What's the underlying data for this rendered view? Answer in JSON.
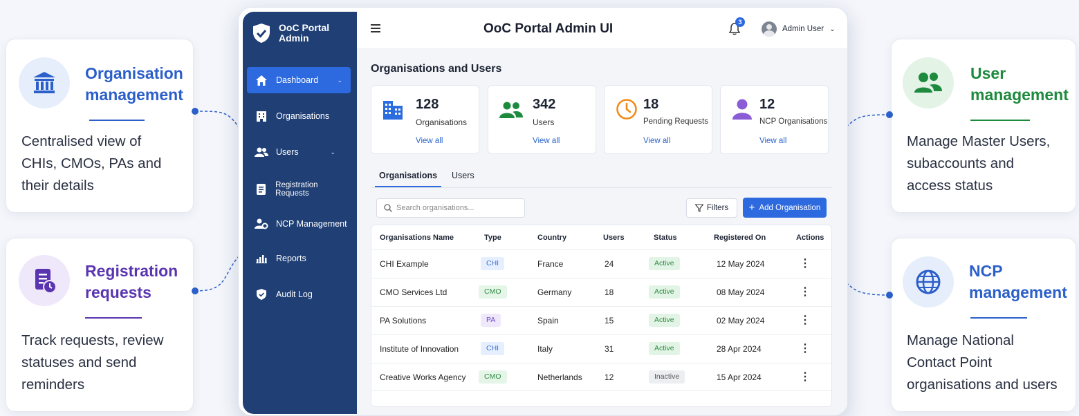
{
  "callouts": {
    "org": {
      "title_line1": "Organisation",
      "title_line2": "management",
      "desc_line1": "Centralised view of",
      "desc_line2": "CHIs, CMOs, PAs and",
      "desc_line3": "their details",
      "icon": "institution-icon",
      "color": "#2b5fc9"
    },
    "reg": {
      "title_line1": "Registration",
      "title_line2": "requests",
      "desc_line1": "Track requests, review",
      "desc_line2": "statuses and send",
      "desc_line3": "reminders",
      "icon": "document-clock-icon",
      "color": "#5a35b0"
    },
    "user": {
      "title_line1": "User",
      "title_line2": "management",
      "desc_line1": "Manage Master Users,",
      "desc_line2": "subaccounts and",
      "desc_line3": "access status",
      "icon": "users-icon",
      "color": "#1e8a3e"
    },
    "ncp": {
      "title_line1": "NCP",
      "title_line2": "management",
      "desc_line1": "Manage National",
      "desc_line2": "Contact Point",
      "desc_line3": "organisations and users",
      "icon": "globe-icon",
      "color": "#2b5fc9"
    }
  },
  "app": {
    "brand_line1": "OoC Portal",
    "brand_line2": "Admin",
    "title": "OoC Portal Admin UI",
    "notification_count": "3",
    "user_name": "Admin User",
    "colors": {
      "sidebar": "#1f3f75",
      "accent": "#2d6ae0"
    }
  },
  "sidebar": {
    "items": [
      {
        "label": "Dashboard",
        "icon": "home-icon"
      },
      {
        "label": "Organisations",
        "icon": "building-icon"
      },
      {
        "label": "Users",
        "icon": "users-icon"
      },
      {
        "label": "Registration Requests",
        "icon": "document-icon"
      },
      {
        "label": "NCP Management",
        "icon": "user-gear-icon"
      },
      {
        "label": "Reports",
        "icon": "bar-chart-icon"
      },
      {
        "label": "Audit Log",
        "icon": "shield-icon"
      }
    ]
  },
  "page": {
    "heading": "Organisations and Users",
    "stats": [
      {
        "value": "128",
        "label": "Organisations",
        "link": "View all"
      },
      {
        "value": "342",
        "label": "Users",
        "link": "View all"
      },
      {
        "value": "18",
        "label": "Pending Requests",
        "link": "View all"
      },
      {
        "value": "12",
        "label": "NCP Organisations",
        "link": "View all"
      }
    ],
    "tabs": [
      "Organisations",
      "Users"
    ],
    "search_placeholder": "Search organisations...",
    "filters_label": "Filters",
    "add_label": "Add Organisation",
    "columns": [
      "Organisations Name",
      "Type",
      "Country",
      "Users",
      "Status",
      "Registered On",
      "Actions"
    ],
    "rows": [
      {
        "name": "CHI Example",
        "type": "CHI",
        "country": "France",
        "users": "24",
        "status": "Active",
        "date": "12 May 2024"
      },
      {
        "name": "CMO Services Ltd",
        "type": "CMO",
        "country": "Germany",
        "users": "18",
        "status": "Active",
        "date": "08 May 2024"
      },
      {
        "name": "PA Solutions",
        "type": "PA",
        "country": "Spain",
        "users": "15",
        "status": "Active",
        "date": "02 May 2024"
      },
      {
        "name": "Institute of Innovation",
        "type": "CHI",
        "country": "Italy",
        "users": "31",
        "status": "Active",
        "date": "28 Apr 2024"
      },
      {
        "name": "Creative Works Agency",
        "type": "CMO",
        "country": "Netherlands",
        "users": "12",
        "status": "Inactive",
        "date": "15 Apr 2024"
      }
    ]
  }
}
